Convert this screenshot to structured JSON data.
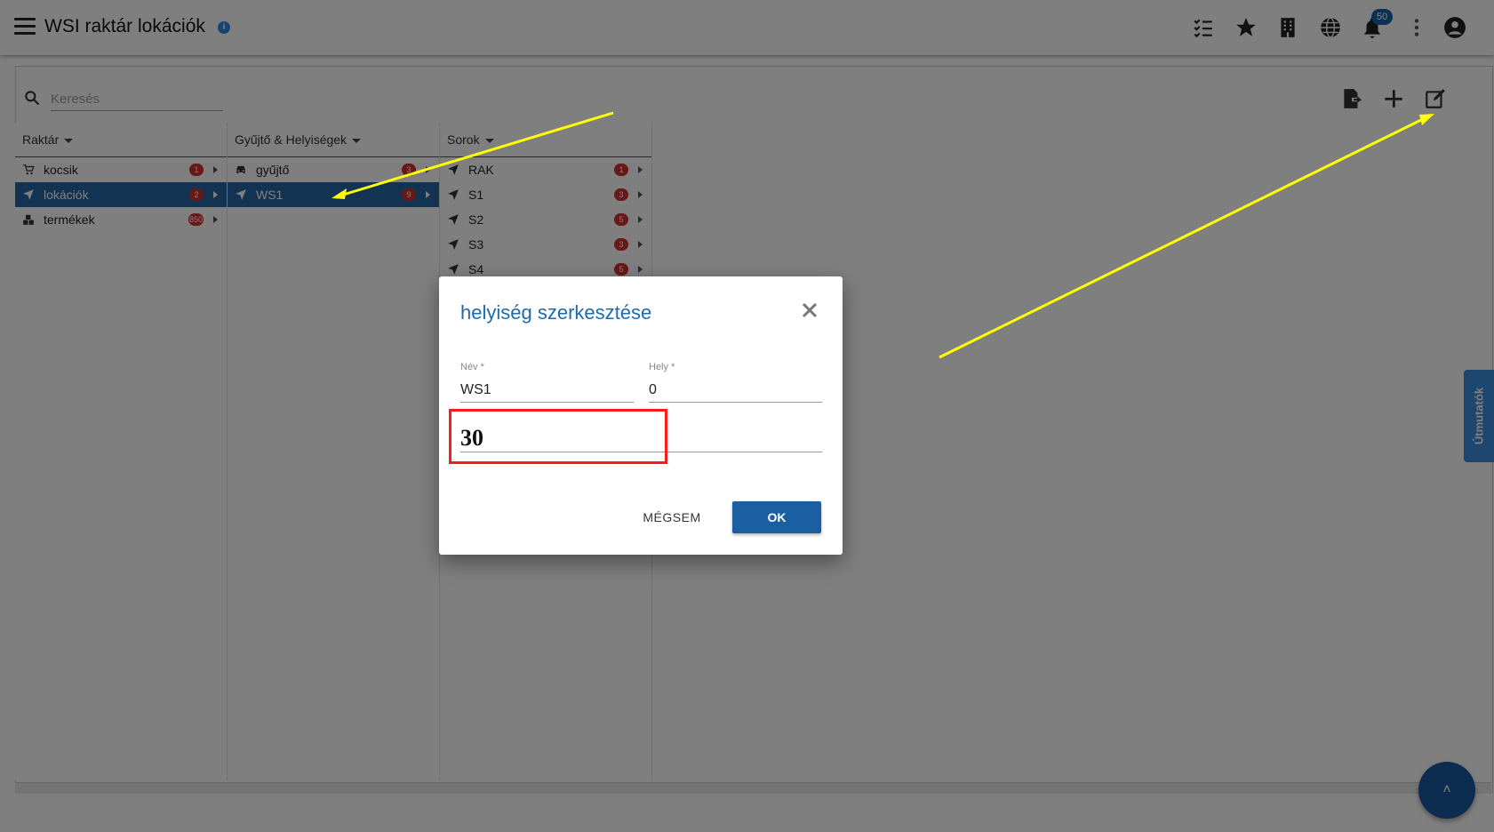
{
  "header": {
    "title": "WSI raktár lokációk",
    "info_icon": "info-icon",
    "notification_count": "50",
    "icons": [
      "checklist-icon",
      "star-icon",
      "building-icon",
      "globe-icon",
      "bell-icon",
      "more-vert-icon",
      "account-circle-icon"
    ]
  },
  "search": {
    "placeholder": "Keresés"
  },
  "toolbar": {
    "icons": [
      "export-icon",
      "add-icon",
      "edit-icon"
    ]
  },
  "columns": [
    {
      "header": "Raktár",
      "rows": [
        {
          "label": "kocsik",
          "badge": "1",
          "icon": "cart-icon",
          "selected": false
        },
        {
          "label": "lokációk",
          "badge": "2",
          "icon": "location-arrow-icon",
          "selected": true
        },
        {
          "label": "termékek",
          "badge": "850",
          "icon": "boxes-icon",
          "selected": false
        }
      ]
    },
    {
      "header": "Gyűjtő & Helyiségek",
      "rows": [
        {
          "label": "gyűjtő",
          "badge": "3",
          "icon": "car-icon",
          "selected": false
        },
        {
          "label": "WS1",
          "badge": "9",
          "icon": "location-arrow-icon",
          "selected": true
        }
      ]
    },
    {
      "header": "Sorok",
      "rows": [
        {
          "label": "RAK",
          "badge": "1",
          "icon": "location-arrow-icon",
          "selected": false
        },
        {
          "label": "S1",
          "badge": "3",
          "icon": "location-arrow-icon",
          "selected": false
        },
        {
          "label": "S2",
          "badge": "5",
          "icon": "location-arrow-icon",
          "selected": false
        },
        {
          "label": "S3",
          "badge": "3",
          "icon": "location-arrow-icon",
          "selected": false
        },
        {
          "label": "S4",
          "badge": "5",
          "icon": "location-arrow-icon",
          "selected": false
        }
      ]
    }
  ],
  "guide_tab": {
    "label": "Útmutatók"
  },
  "fab": {
    "icon": "chevron-up-icon",
    "label": "˄"
  },
  "dialog": {
    "title": "helyiség szerkesztése",
    "name_label": "Név *",
    "name_value": "WS1",
    "place_label": "Hely *",
    "place_value": "0",
    "third_value": "30",
    "cancel_label": "MÉGSEM",
    "ok_label": "OK"
  },
  "colors": {
    "accent": "#1b5fa3",
    "selected_row": "#2766a6",
    "badge": "#d32f2f",
    "annotation_arrow": "#ffff00",
    "annotation_box": "#ff1a1a"
  }
}
